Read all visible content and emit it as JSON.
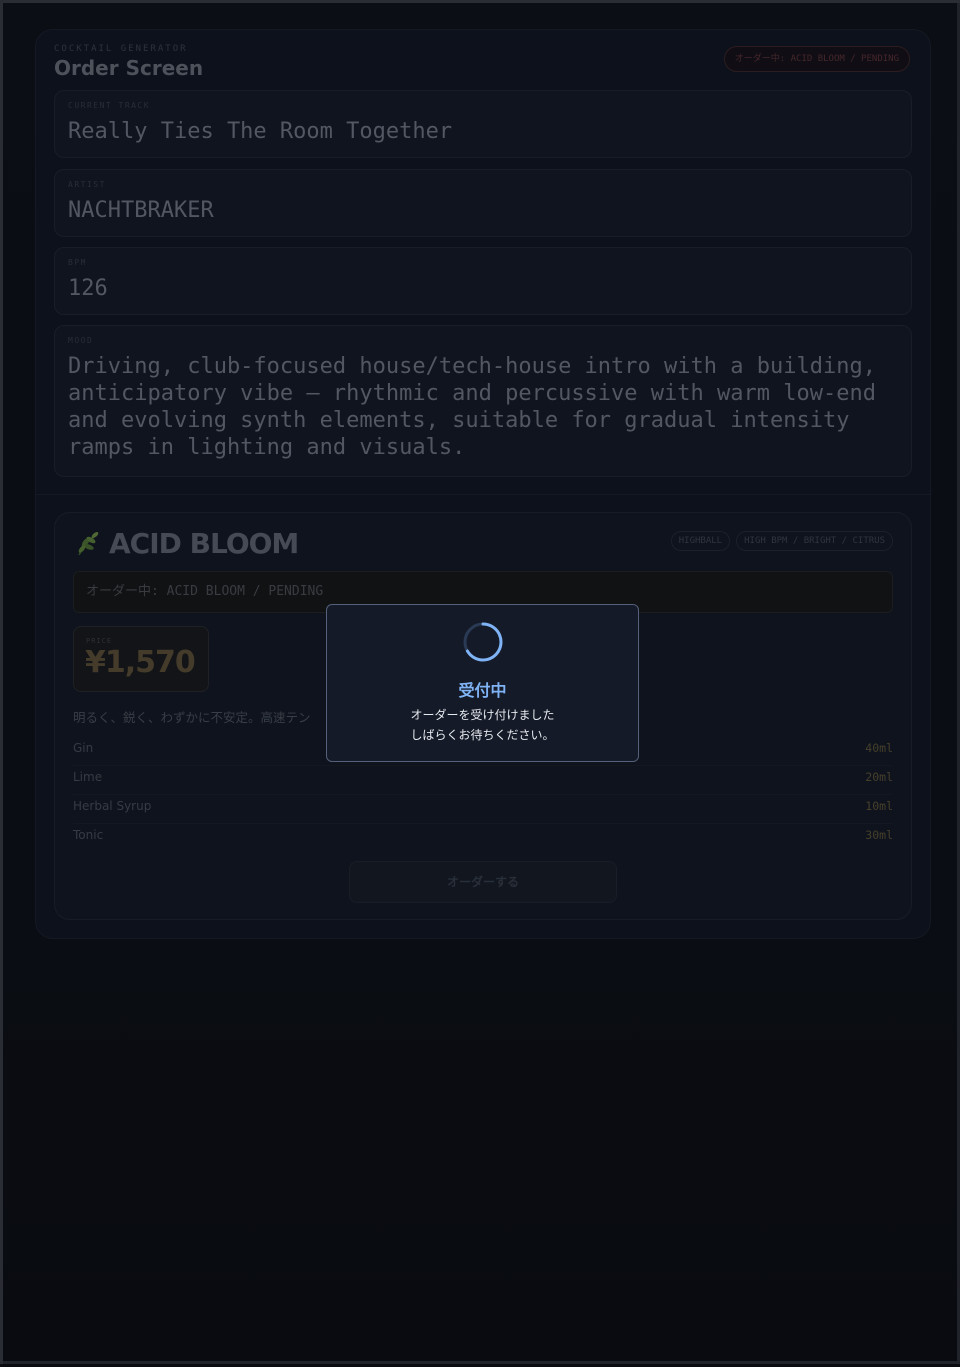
{
  "header": {
    "eyebrow": "COCKTAIL GENERATOR",
    "title": "Order Screen",
    "status_chip": "オーダー中: ACID BLOOM / PENDING"
  },
  "fields": {
    "track": {
      "label": "CURRENT TRACK",
      "value": "Really Ties The Room Together"
    },
    "artist": {
      "label": "ARTIST",
      "value": "NACHTBRAKER"
    },
    "bpm": {
      "label": "BPM",
      "value": "126"
    },
    "mood": {
      "label": "MOOD",
      "value": "Driving, club-focused house/tech-house intro with a building, anticipatory vibe — rhythmic and percussive with warm low-end and evolving synth elements, suitable for gradual intensity ramps in lighting and visuals."
    }
  },
  "cocktail": {
    "icon": "leaf-icon",
    "name": "ACID BLOOM",
    "tags": [
      "HIGHBALL",
      "HIGH BPM / BRIGHT / CITRUS"
    ],
    "order_status": "オーダー中: ACID BLOOM / PENDING",
    "price_label": "PRICE",
    "price": "¥1,570",
    "description": "明るく、鋭く、わずかに不安定。高速テン",
    "ingredients": [
      {
        "name": "Gin",
        "amount": "40ml"
      },
      {
        "name": "Lime",
        "amount": "20ml"
      },
      {
        "name": "Herbal Syrup",
        "amount": "10ml"
      },
      {
        "name": "Tonic",
        "amount": "30ml"
      }
    ],
    "order_button": "オーダーする"
  },
  "modal": {
    "icon": "spinner-icon",
    "title": "受付中",
    "line1": "オーダーを受け付けました",
    "line2": "しばらくお待ちください。"
  },
  "colors": {
    "accent": "#7fb3f5",
    "background": "#0b0d12",
    "price": "#5a4d34",
    "pending": "#5b3136"
  }
}
